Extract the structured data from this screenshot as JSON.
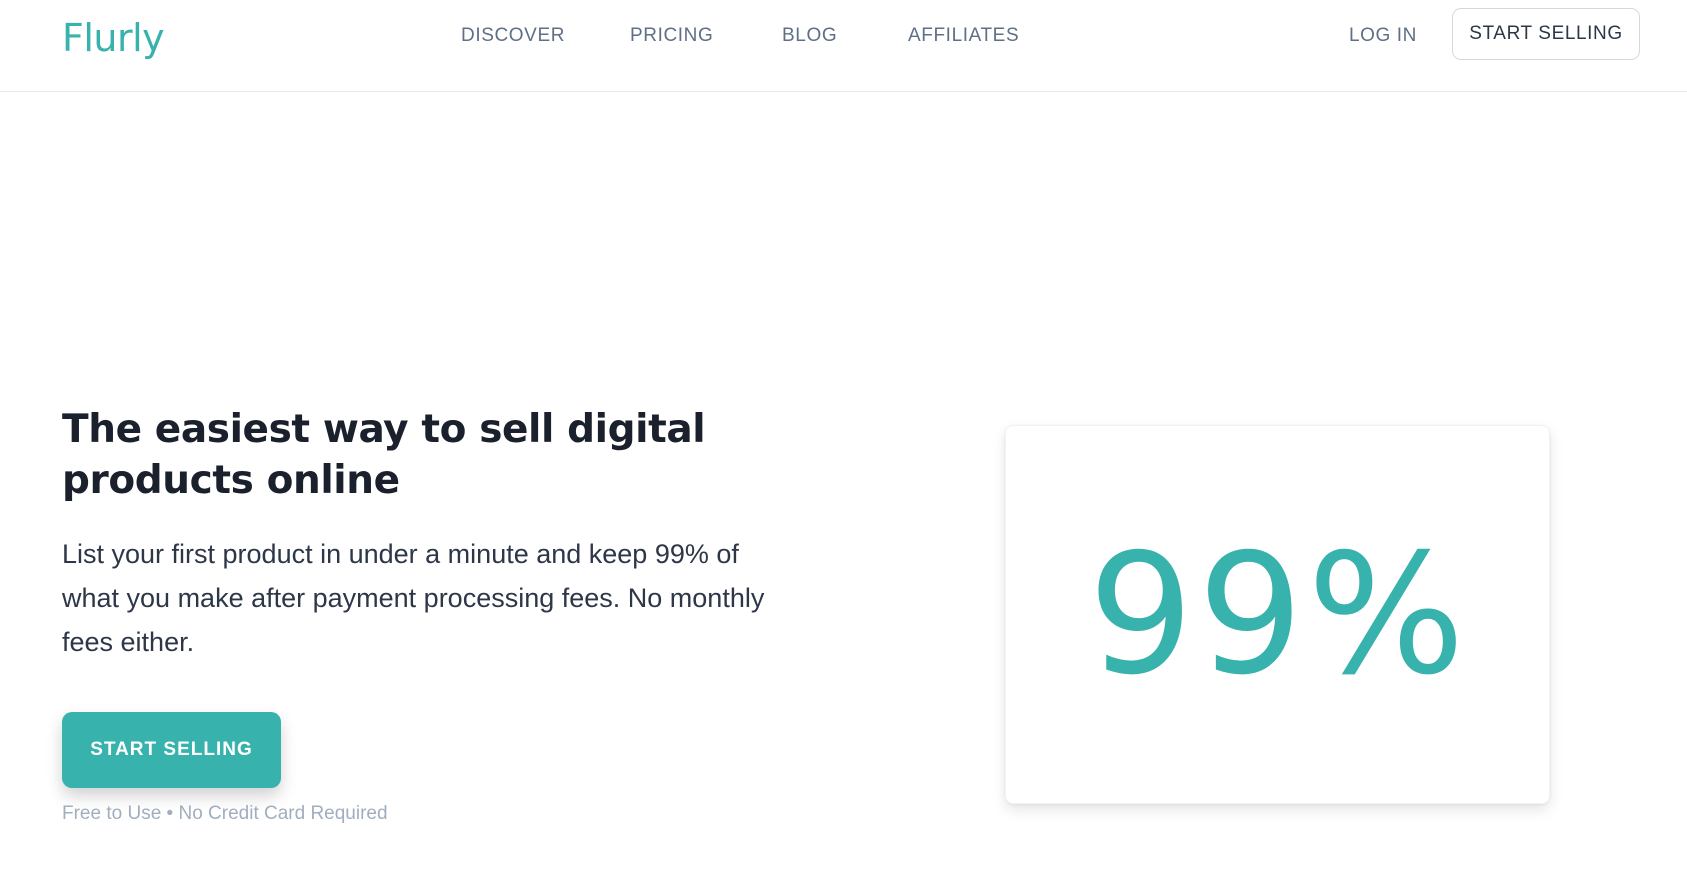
{
  "header": {
    "logo": "Flurly",
    "nav": {
      "discover": "DISCOVER",
      "pricing": "PRICING",
      "blog": "BLOG",
      "affiliates": "AFFILIATES"
    },
    "login": "LOG IN",
    "cta": "START SELLING"
  },
  "hero": {
    "title": "The easiest way to sell digital products online",
    "subtitle": "List your first product in under a minute and keep 99% of what you make after payment processing fees. No monthly fees either.",
    "cta": "START SELLING",
    "note": "Free to Use • No Credit Card Required"
  },
  "stat": {
    "value": "99%"
  },
  "colors": {
    "accent": "#38b2ac",
    "heading": "#1a202c",
    "nav_text": "#5f6f86",
    "muted": "#a0aec0"
  }
}
